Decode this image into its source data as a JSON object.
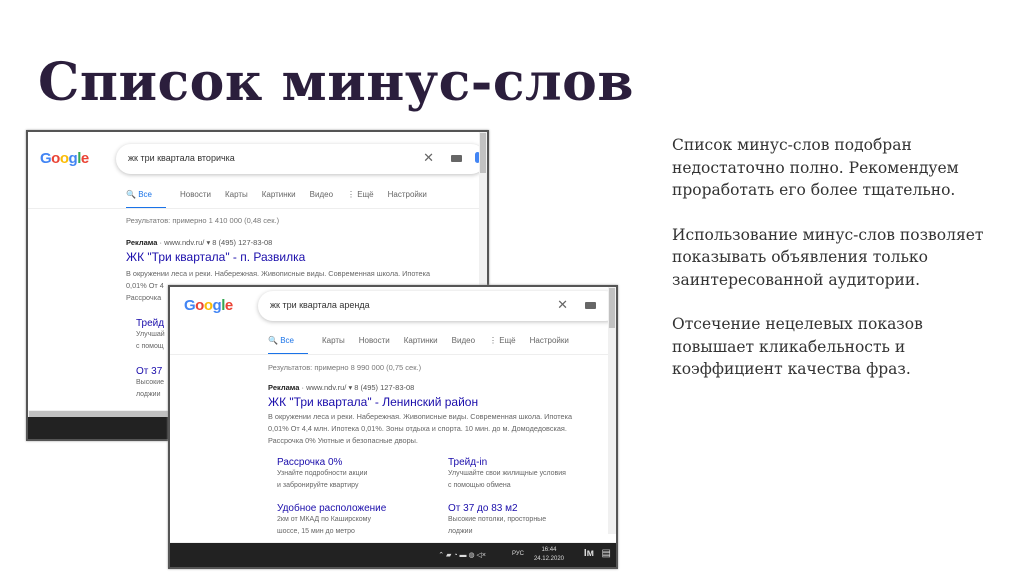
{
  "slide": {
    "title": "Список минус-слов",
    "notes": [
      "Список минус-слов подобран недостаточно полно. Рекомендуем проработать его более тщательно.",
      "Использование минус-слов позволяет показывать объявления только заинтересованной аудитории.",
      "Отсечение нецелевых показов повышает кликабельность и коэффициент качества фраз."
    ]
  },
  "shot1": {
    "logo": "Google",
    "query": "жк три квартала вторичка",
    "tabs": [
      "Все",
      "Новости",
      "Карты",
      "Картинки",
      "Видео",
      "⋮ Ещё",
      "Настройки"
    ],
    "results_count": "Результатов: примерно 1 410 000 (0,48 сек.)",
    "ad_label": "Реклама",
    "ad_url": "· www.ndv.ru/ ▾  8 (495) 127-83-08",
    "headline": "ЖК \"Три квартала\" - п. Развилка",
    "desc": [
      "В окружении леса и реки. Набережная. Живописные виды. Современная школа. Ипотека",
      "0,01% От 4",
      "Рассрочка"
    ],
    "sitelinks": [
      {
        "title": "Трейд",
        "d1": "Улучшай",
        "d2": "с помощ"
      },
      {
        "title": "От 37",
        "d1": "Высокие",
        "d2": "лоджии"
      }
    ]
  },
  "shot2": {
    "logo": "Google",
    "query": "жк три квартала аренда",
    "tabs": [
      "Все",
      "Карты",
      "Новости",
      "Картинки",
      "Видео",
      "⋮ Ещё",
      "Настройки"
    ],
    "results_count": "Результатов: примерно 8 990 000 (0,75 сек.)",
    "ad_label": "Реклама",
    "ad_url": "· www.ndv.ru/ ▾  8 (495) 127-83-08",
    "headline": "ЖК \"Три квартала\" - Ленинский район",
    "desc": [
      "В окружении леса и реки. Набережная. Живописные виды. Современная школа. Ипотека",
      "0,01% От 4,4 млн. Ипотека 0,01%. Зоны отдыха и спорта. 10 мин. до м. Домодедовская.",
      "Рассрочка 0% Уютные и безопасные дворы."
    ],
    "sitelinks": [
      {
        "title": "Рассрочка 0%",
        "d1": "Узнайте подробности акции",
        "d2": "и забронируйте квартиру"
      },
      {
        "title": "Трейд-in",
        "d1": "Улучшайте свои жилищные условия",
        "d2": "с помощью обмена"
      },
      {
        "title": "Удобное расположение",
        "d1": "2км от МКАД по Каширскому",
        "d2": "шоссе, 15 мин до метро"
      },
      {
        "title": "От 37 до 83 м2",
        "d1": "Высокие потолки, просторные",
        "d2": "лоджии"
      }
    ],
    "taskbar": {
      "lang": "РУС",
      "time": "16:44",
      "date": "24.12.2020"
    }
  }
}
